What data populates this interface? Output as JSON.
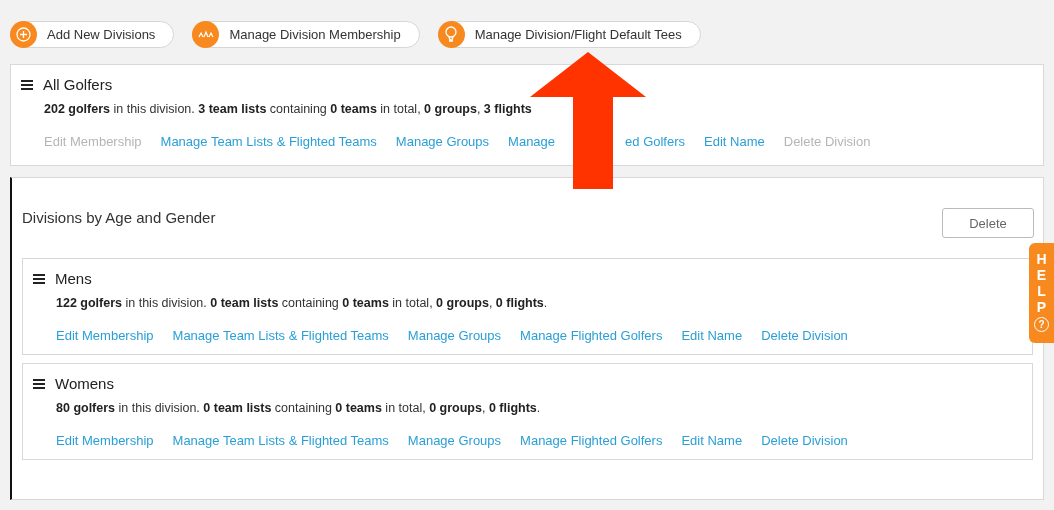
{
  "toolbar": [
    {
      "label": "Add New Divisions"
    },
    {
      "label": "Manage Division Membership"
    },
    {
      "label": "Manage Division/Flight Default Tees"
    }
  ],
  "all_golfers": {
    "title": "All Golfers",
    "summary": "**202 golfers** in this division. **3 team lists** containing **0 teams** in total, **0 groups**, **3 flights**",
    "links": [
      {
        "parts": [
          "Edit Membership"
        ],
        "disabled": true
      },
      {
        "parts": [
          "Manage Team Lists & Flighted Teams"
        ],
        "disabled": false
      },
      {
        "parts": [
          "Manage Groups"
        ],
        "disabled": false
      },
      {
        "parts": [
          "Manage",
          "ed Golfers"
        ],
        "disabled": false
      },
      {
        "parts": [
          "Edit Name"
        ],
        "disabled": false
      },
      {
        "parts": [
          "Delete Division"
        ],
        "disabled": true
      }
    ]
  },
  "section": {
    "title": "Divisions by Age and Gender",
    "delete_button": "Delete",
    "divisions": [
      {
        "title": "Mens",
        "summary": "**122 golfers** in this division. **0 team lists** containing **0 teams** in total, **0 groups**, **0 flights**.",
        "links": [
          {
            "parts": [
              "Edit Membership"
            ],
            "disabled": false
          },
          {
            "parts": [
              "Manage Team Lists & Flighted Teams"
            ],
            "disabled": false
          },
          {
            "parts": [
              "Manage Groups"
            ],
            "disabled": false
          },
          {
            "parts": [
              "Manage Flighted Golfers"
            ],
            "disabled": false
          },
          {
            "parts": [
              "Edit Name"
            ],
            "disabled": false
          },
          {
            "parts": [
              "Delete Division"
            ],
            "disabled": false
          }
        ]
      },
      {
        "title": "Womens",
        "summary": "**80 golfers** in this division. **0 team lists** containing **0 teams** in total, **0 groups**, **0 flights**.",
        "links": [
          {
            "parts": [
              "Edit Membership"
            ],
            "disabled": false
          },
          {
            "parts": [
              "Manage Team Lists & Flighted Teams"
            ],
            "disabled": false
          },
          {
            "parts": [
              "Manage Groups"
            ],
            "disabled": false
          },
          {
            "parts": [
              "Manage Flighted Golfers"
            ],
            "disabled": false
          },
          {
            "parts": [
              "Edit Name"
            ],
            "disabled": false
          },
          {
            "parts": [
              "Delete Division"
            ],
            "disabled": false
          }
        ]
      }
    ]
  },
  "help_tab": {
    "letters": [
      "H",
      "E",
      "L",
      "P"
    ],
    "icon": "?"
  }
}
